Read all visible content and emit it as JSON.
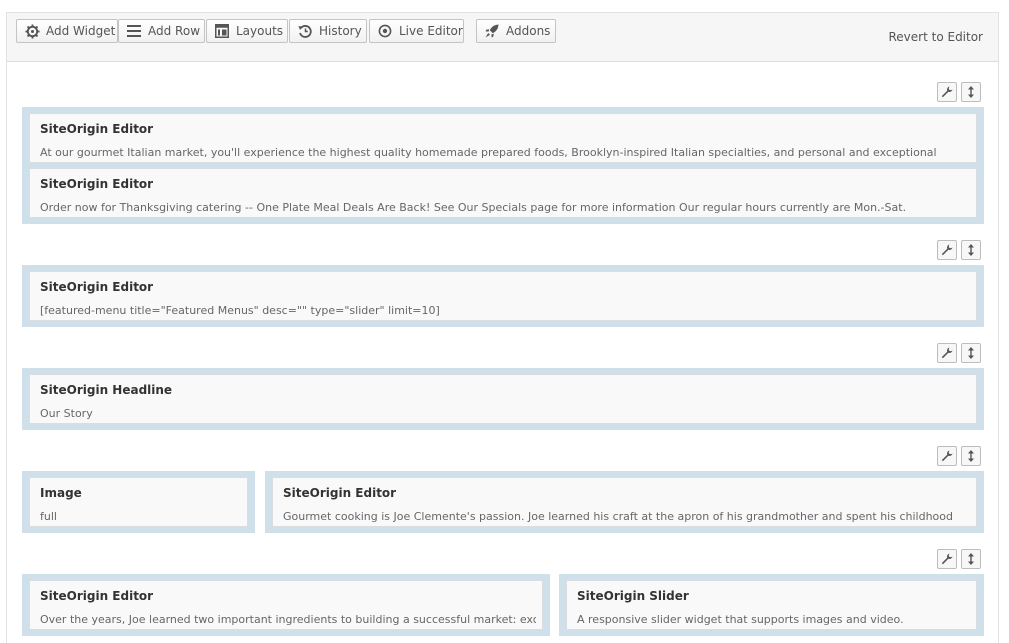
{
  "toolbar": {
    "buttons": [
      {
        "label": "Add Widget",
        "icon": "gear-icon"
      },
      {
        "label": "Add Row",
        "icon": "rows-icon"
      },
      {
        "label": "Layouts",
        "icon": "layouts-icon"
      },
      {
        "label": "History",
        "icon": "history-icon"
      },
      {
        "label": "Live Editor",
        "icon": "eye-icon"
      },
      {
        "label": "Addons",
        "icon": "rocket-icon"
      }
    ],
    "revert_label": "Revert to Editor"
  },
  "rows": [
    {
      "widgets": [
        {
          "title": "SiteOrigin Editor",
          "description": "At our gourmet Italian market, you'll experience the highest quality homemade prepared foods, Brooklyn-inspired Italian specialties, and personal and exceptional"
        },
        {
          "title": "SiteOrigin Editor",
          "description": "Order now for Thanksgiving catering -- One Plate Meal Deals Are Back! See Our Specials page for more information Our regular hours currently are Mon.-Sat."
        }
      ]
    },
    {
      "widgets": [
        {
          "title": "SiteOrigin Editor",
          "description": "[featured-menu title=\"Featured Menus\" desc=\"\" type=\"slider\" limit=10]"
        }
      ]
    },
    {
      "widgets": [
        {
          "title": "SiteOrigin Headline",
          "description": "Our Story"
        }
      ]
    },
    {
      "widgets": [
        {
          "title": "Image",
          "description": "full"
        },
        {
          "title": "SiteOrigin Editor",
          "description": "Gourmet cooking is Joe Clemente's passion. Joe learned his craft at the apron of his grandmother and spent his childhood"
        }
      ]
    },
    {
      "widgets": [
        {
          "title": "SiteOrigin Editor",
          "description": "Over the years, Joe learned two important ingredients to building a successful market: exceptional"
        },
        {
          "title": "SiteOrigin Slider",
          "description": "A responsive slider widget that supports images and video."
        }
      ]
    }
  ],
  "row_tool_icons": [
    "wrench-icon",
    "move-icon"
  ],
  "colors": {
    "cell_border": "#cfe0ea",
    "widget_bg": "#f9f9fa",
    "toolbar_bg": "#f6f6f6"
  }
}
